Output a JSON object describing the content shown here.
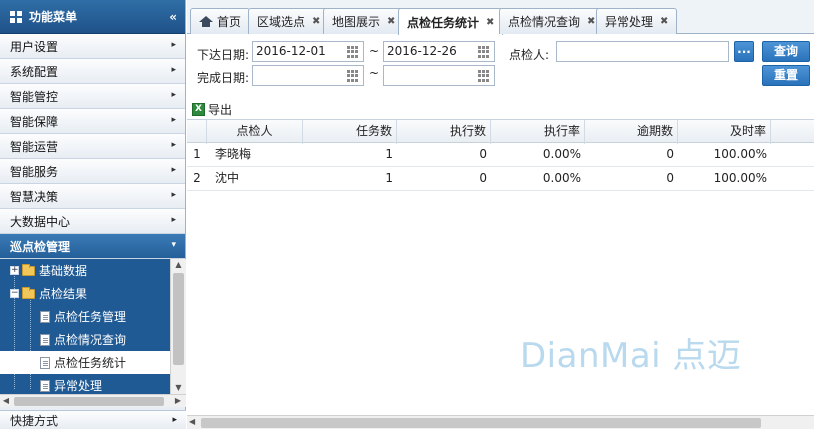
{
  "sidebar": {
    "title": "功能菜单",
    "collapse_icon": "double-chevron-left-icon",
    "items": [
      {
        "label": "用户设置"
      },
      {
        "label": "系统配置"
      },
      {
        "label": "智能管控"
      },
      {
        "label": "智能保障"
      },
      {
        "label": "智能运营"
      },
      {
        "label": "智能服务"
      },
      {
        "label": "智慧决策"
      },
      {
        "label": "大数据中心"
      },
      {
        "label": "巡点检管理",
        "active": true
      }
    ],
    "tree": [
      {
        "label": "基础数据",
        "type": "folder",
        "expanded": false
      },
      {
        "label": "点检结果",
        "type": "folder",
        "expanded": true
      },
      {
        "label": "点检任务管理",
        "type": "doc"
      },
      {
        "label": "点检情况查询",
        "type": "doc"
      },
      {
        "label": "点检任务统计",
        "type": "doc",
        "selected": true
      },
      {
        "label": "异常处理",
        "type": "doc"
      }
    ],
    "quick_label": "快捷方式"
  },
  "tabs": [
    {
      "label": "首页",
      "icon": "home-icon",
      "closable": false
    },
    {
      "label": "区域选点",
      "closable": true
    },
    {
      "label": "地图展示",
      "closable": true
    },
    {
      "label": "点检任务统计",
      "closable": true,
      "active": true
    },
    {
      "label": "点检情况查询",
      "closable": true
    },
    {
      "label": "异常处理",
      "closable": true
    }
  ],
  "search": {
    "issue_date_label": "下达日期:",
    "issue_date_from": "2016-12-01",
    "issue_date_to": "2016-12-26",
    "range_sep": "~",
    "complete_date_label": "完成日期:",
    "complete_date_from": "",
    "complete_date_to": "",
    "inspector_label": "点检人:",
    "inspector_value": "",
    "picker_label": "...",
    "query_label": "查询",
    "reset_label": "重置"
  },
  "toolbar": {
    "export_label": "导出"
  },
  "grid": {
    "columns": [
      "点检人",
      "任务数",
      "执行数",
      "执行率",
      "逾期数",
      "及时率"
    ],
    "rows": [
      {
        "index": "1",
        "inspector": "李晓梅",
        "tasks": "1",
        "executed": "0",
        "exec_rate": "0.00%",
        "overdue": "0",
        "ontime_rate": "100.00%"
      },
      {
        "index": "2",
        "inspector": "沈中",
        "tasks": "1",
        "executed": "0",
        "exec_rate": "0.00%",
        "overdue": "0",
        "ontime_rate": "100.00%"
      }
    ]
  },
  "watermark": "DianMai 点迈"
}
